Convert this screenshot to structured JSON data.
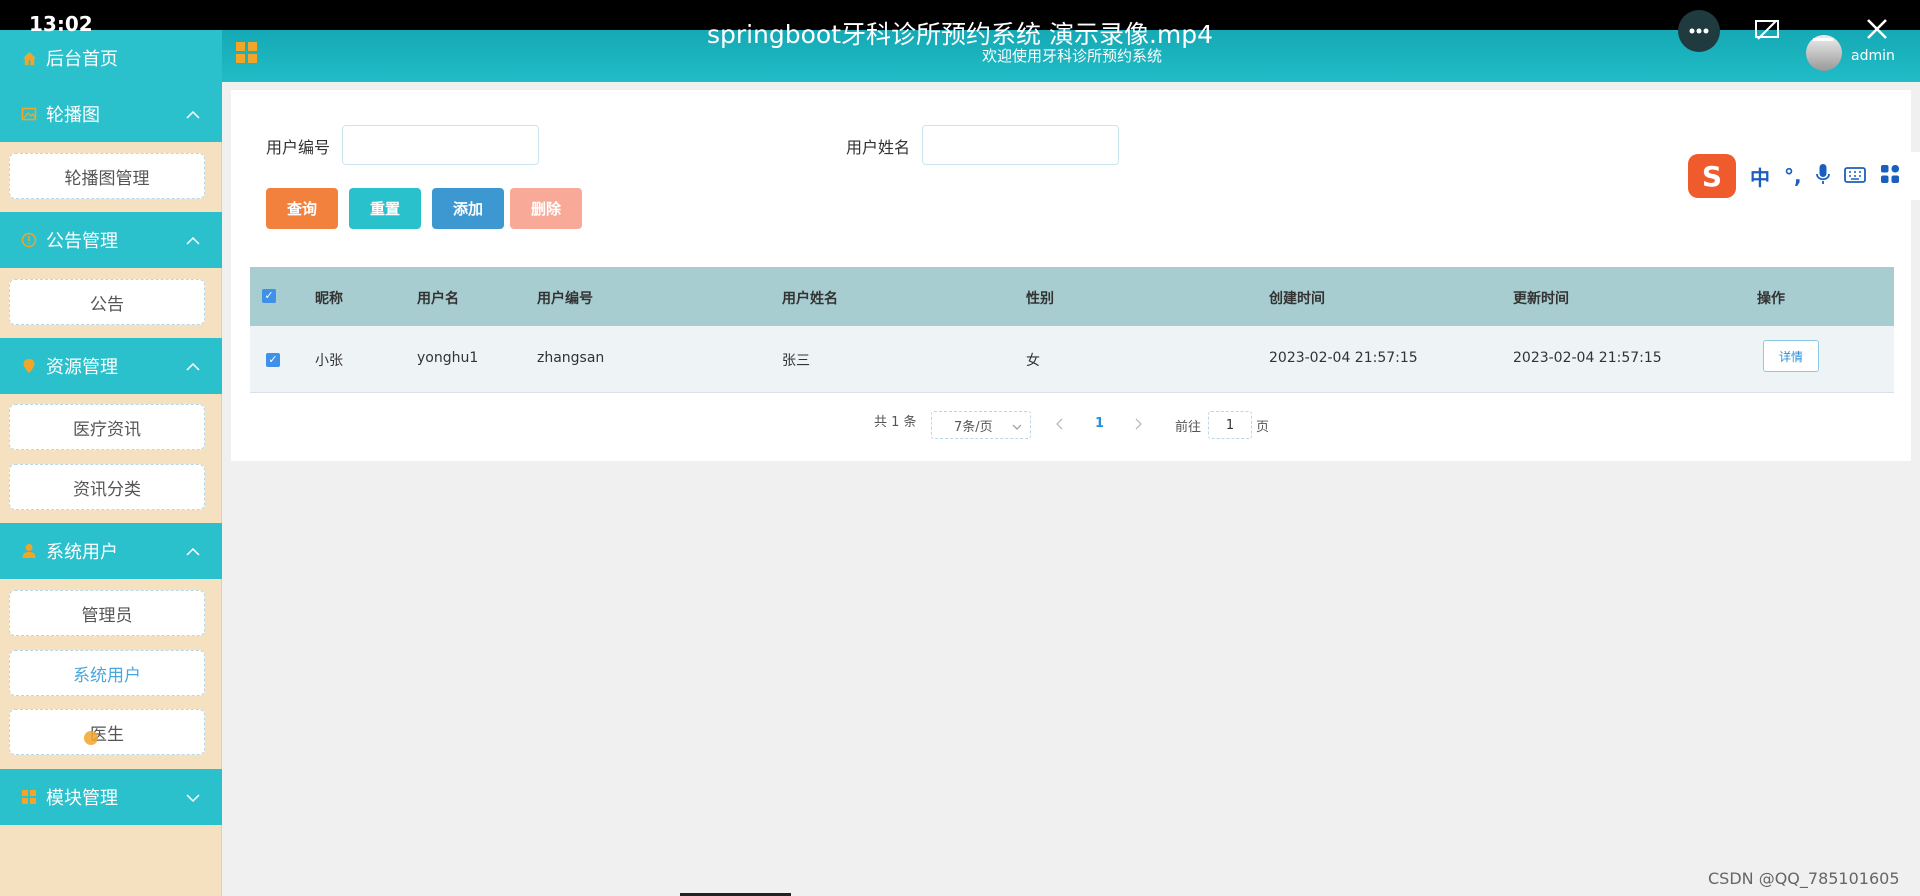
{
  "status": {
    "time": "13:02"
  },
  "video": {
    "title": "springboot牙科诊所预约系统 演示录像.mp4"
  },
  "header": {
    "welcome": "欢迎使用牙科诊所预约系统",
    "user": "admin"
  },
  "sidebar": {
    "home": "后台首页",
    "sections": [
      {
        "label": "轮播图",
        "icon": "image-icon",
        "items": [
          "轮播图管理"
        ]
      },
      {
        "label": "公告管理",
        "icon": "info-icon",
        "items": [
          "公告"
        ]
      },
      {
        "label": "资源管理",
        "icon": "location-icon",
        "items": [
          "医疗资讯",
          "资讯分类"
        ]
      },
      {
        "label": "系统用户",
        "icon": "user-icon",
        "items": [
          "管理员",
          "系统用户",
          "医生"
        ]
      },
      {
        "label": "模块管理",
        "icon": "grid-icon",
        "items": []
      }
    ],
    "active_item": "系统用户"
  },
  "search": {
    "user_no_label": "用户编号",
    "user_name_label": "用户姓名",
    "user_no_value": "",
    "user_name_value": ""
  },
  "buttons": {
    "query": "查询",
    "reset": "重置",
    "add": "添加",
    "delete": "删除"
  },
  "colors": {
    "query": "#f2813e",
    "reset": "#29c1cc",
    "add": "#3d97d1",
    "delete": "#f8a997",
    "accent": "#2bc1cc"
  },
  "table": {
    "headers": [
      "昵称",
      "用户名",
      "用户编号",
      "用户姓名",
      "性别",
      "创建时间",
      "更新时间",
      "操作"
    ],
    "rows": [
      {
        "nickname": "小张",
        "username": "yonghu1",
        "user_no": "zhangsan",
        "user_name": "张三",
        "gender": "女",
        "created": "2023-02-04 21:57:15",
        "updated": "2023-02-04 21:57:15",
        "action": "详情"
      }
    ]
  },
  "pagination": {
    "total": "共 1 条",
    "page_size": "7条/页",
    "current": "1",
    "goto_prefix": "前往",
    "goto_value": "1",
    "goto_suffix": "页"
  },
  "ime": {
    "chars": [
      "中",
      "°,"
    ]
  },
  "watermark": "CSDN @QQ_785101605"
}
